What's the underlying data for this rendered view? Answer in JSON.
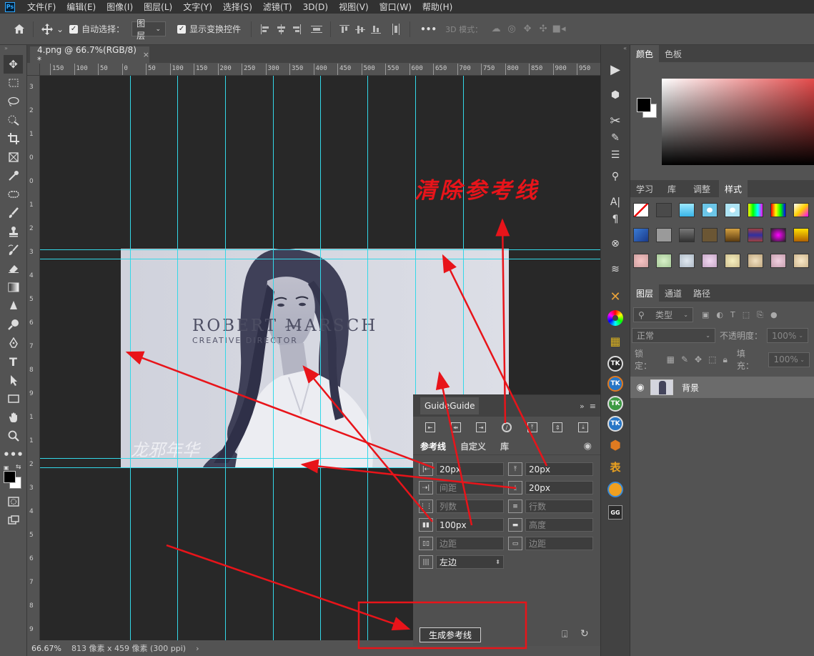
{
  "menu": {
    "logo": "Ps",
    "items": [
      "文件(F)",
      "编辑(E)",
      "图像(I)",
      "图层(L)",
      "文字(Y)",
      "选择(S)",
      "滤镜(T)",
      "3D(D)",
      "视图(V)",
      "窗口(W)",
      "帮助(H)"
    ]
  },
  "options": {
    "auto_select_label": "自动选择：",
    "auto_select_target": "图层",
    "show_transform_label": "显示变换控件",
    "mode_3d_label": "3D 模式："
  },
  "document": {
    "tab_title": "4.png @ 66.7%(RGB/8) *",
    "zoom": "66.67%",
    "dimensions": "813 像素 x 459 像素 (300 ppi)",
    "ruler_top_labels": [
      "150",
      "100",
      "50",
      "0",
      "50",
      "100",
      "150",
      "200",
      "250",
      "300",
      "350",
      "400",
      "450",
      "500",
      "550",
      "600",
      "650",
      "700",
      "750",
      "800",
      "850",
      "900",
      "950"
    ],
    "ruler_left_labels": [
      "3",
      "2",
      "1",
      "0",
      "0",
      "1",
      "2",
      "3",
      "4",
      "5",
      "6",
      "7",
      "8",
      "9",
      "1",
      "1",
      "2",
      "3",
      "4",
      "5",
      "6",
      "7",
      "8",
      "9",
      "1"
    ]
  },
  "photo": {
    "title": "ROBERT MARSCH",
    "subtitle": "CREATIVE DIRECTOR",
    "watermark": "龙邪年华"
  },
  "annotation": {
    "headline": "清除参考线",
    "arrow_color": "#e8141a"
  },
  "guideguide": {
    "title": "GuideGuide",
    "tabs": [
      "参考线",
      "自定义",
      "库"
    ],
    "left_fields": [
      {
        "value": "20px",
        "placeholder": ""
      },
      {
        "value": "",
        "placeholder": "间距"
      },
      {
        "value": "",
        "placeholder": "列数"
      },
      {
        "value": "100px",
        "placeholder": ""
      },
      {
        "value": "",
        "placeholder": "边距"
      }
    ],
    "right_fields": [
      {
        "value": "20px",
        "placeholder": ""
      },
      {
        "value": "20px",
        "placeholder": ""
      },
      {
        "value": "",
        "placeholder": "行数"
      },
      {
        "value": "",
        "placeholder": "高度"
      },
      {
        "value": "",
        "placeholder": "边距"
      }
    ],
    "position_select": "左边",
    "generate_button": "生成参考线"
  },
  "color_panel": {
    "tabs": [
      "颜色",
      "色板"
    ],
    "fg_color": "#000000",
    "bg_color": "#ffffff",
    "hue_color": "#e34a4a"
  },
  "style_panel": {
    "tabs": [
      "学习",
      "库",
      "调整",
      "样式"
    ]
  },
  "layers_panel": {
    "tabs": [
      "图层",
      "通道",
      "路径"
    ],
    "filter_label": "类型",
    "blend_mode": "正常",
    "opacity_label": "不透明度：",
    "opacity_value": "100%",
    "lock_label": "锁定：",
    "fill_label": "填充：",
    "fill_value": "100%",
    "layer_name": "背景"
  },
  "dock": {
    "plugin_label_1": "TK",
    "plugin_label_2": "表",
    "plugin_label_3": "GG"
  }
}
